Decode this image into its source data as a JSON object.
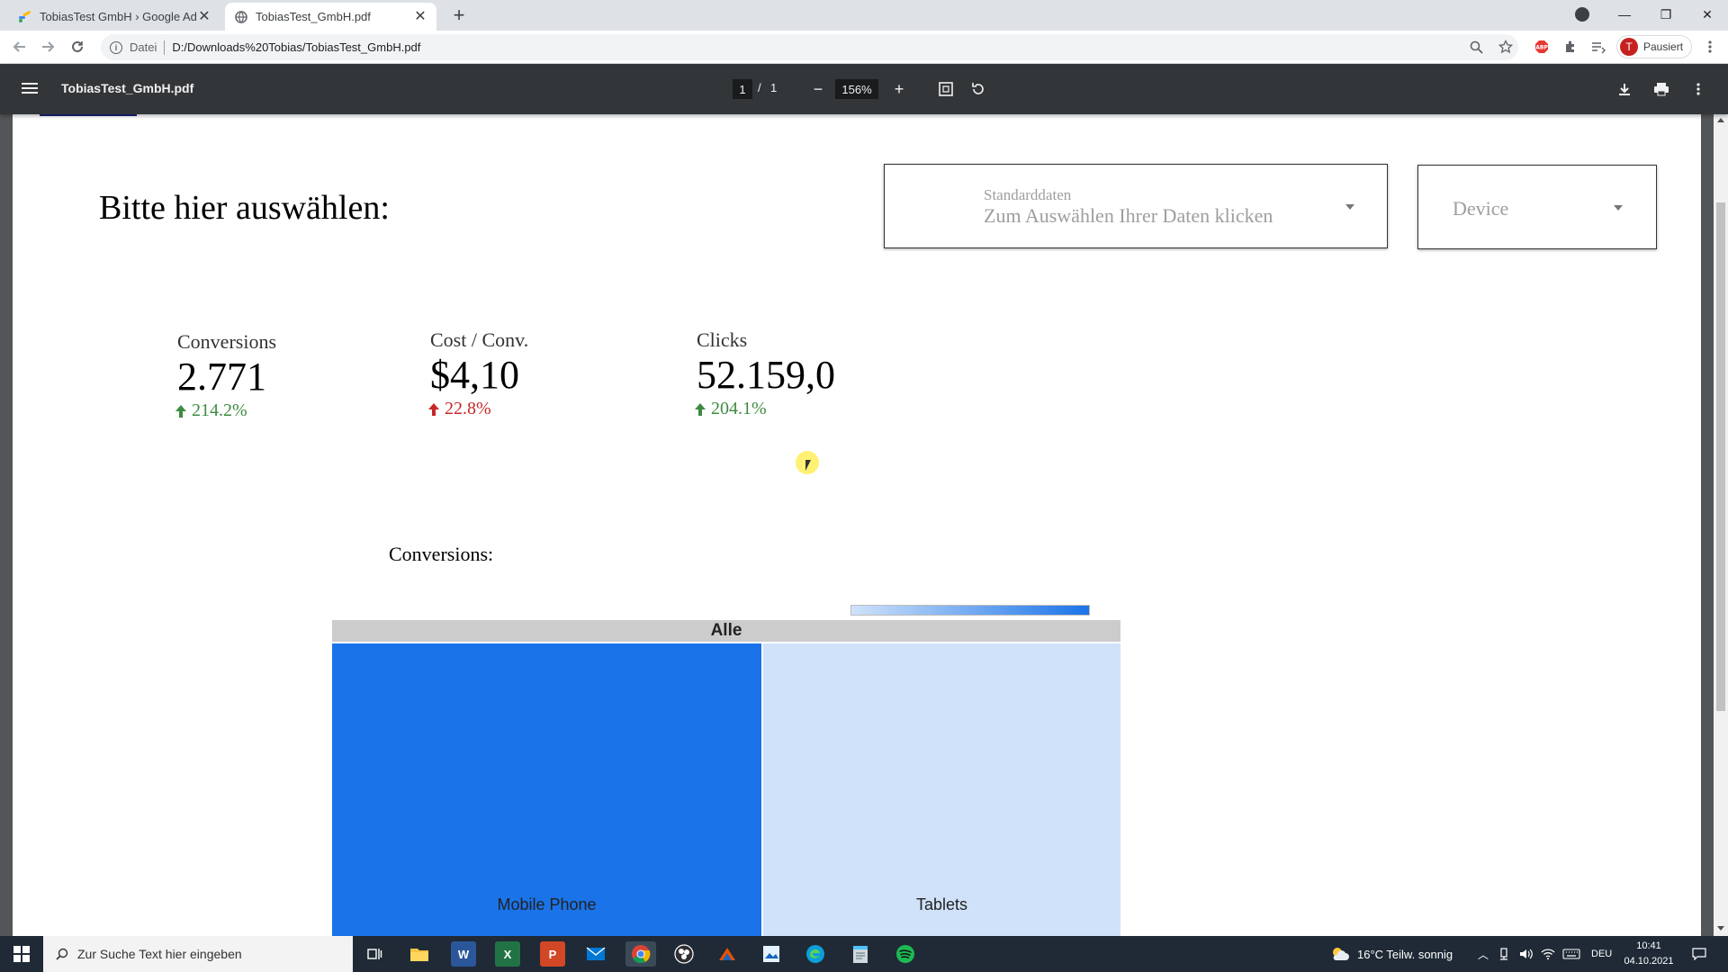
{
  "browser": {
    "tabs": [
      {
        "title": "TobiasTest GmbH › Google Ads",
        "close": "✕"
      },
      {
        "title": "TobiasTest_GmbH.pdf",
        "close": "✕"
      }
    ],
    "new_tab": "+",
    "address": {
      "chip": "Datei",
      "url": "D:/Downloads%20Tobias/TobiasTest_GmbH.pdf"
    },
    "profile": {
      "initial": "T",
      "label": "Pausiert"
    },
    "window_controls": {
      "minimize": "—",
      "restore": "❐",
      "close": "✕"
    }
  },
  "pdf_viewer": {
    "file_name": "TobiasTest_GmbH.pdf",
    "current_page": "1",
    "page_separator": "/",
    "total_pages": "1",
    "zoom": "156%",
    "zoom_out": "−",
    "zoom_in": "+"
  },
  "report": {
    "headline": "Bitte hier auswählen:",
    "date_control": {
      "label": "Standarddaten",
      "placeholder": "Zum Auswählen Ihrer Daten klicken"
    },
    "device_control": {
      "label": "Device"
    },
    "kpis": [
      {
        "label": "Conversions",
        "value": "2.771",
        "change": "214.2%",
        "trend_color": "#3d8b40"
      },
      {
        "label": "Cost / Conv.",
        "value": "$4,10",
        "change": "22.8%",
        "trend_color": "#c62828"
      },
      {
        "label": "Clicks",
        "value": "52.159,0",
        "change": "204.1%",
        "trend_color": "#3d8b40"
      }
    ],
    "section_title": "Conversions:"
  },
  "chart_data": {
    "type": "treemap",
    "root": "Alle",
    "categories": [
      "Mobile Phone",
      "Tablets"
    ],
    "values": [
      0.547,
      0.453
    ],
    "colors": [
      "#1a73e8",
      "#cfe2fa"
    ],
    "color_scale": [
      "#cfe2fa",
      "#1a73e8"
    ]
  },
  "taskbar": {
    "search_placeholder": "Zur Suche Text hier eingeben",
    "weather": "16°C  Teilw. sonnig",
    "language": "DEU",
    "time": "10:41",
    "date": "04.10.2021",
    "apps": [
      {
        "icon": "word-icon",
        "letter": "W",
        "color": "#2b579a"
      },
      {
        "icon": "excel-icon",
        "letter": "X",
        "color": "#217346"
      },
      {
        "icon": "powerpoint-icon",
        "letter": "P",
        "color": "#d24726"
      }
    ]
  }
}
